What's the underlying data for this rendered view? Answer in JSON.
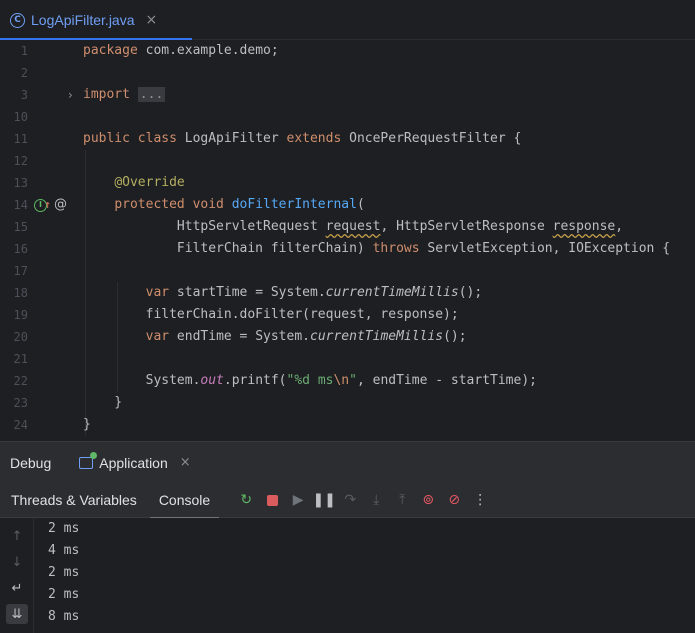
{
  "editor_tab": {
    "file_name": "LogApiFilter.java",
    "icon": "java-class-icon",
    "close": "×"
  },
  "code_lines": [
    {
      "ln": "1",
      "parts": [
        [
          "kw",
          "package"
        ],
        [
          "t",
          " com.example.demo;"
        ]
      ]
    },
    {
      "ln": "2",
      "parts": []
    },
    {
      "ln": "3",
      "parts": [
        [
          "kw",
          "import"
        ],
        [
          "t",
          " "
        ],
        [
          "fold",
          "..."
        ]
      ],
      "fold": true
    },
    {
      "ln": "10",
      "parts": []
    },
    {
      "ln": "11",
      "parts": [
        [
          "kw",
          "public class"
        ],
        [
          "t",
          " LogApiFilter "
        ],
        [
          "kw",
          "extends"
        ],
        [
          "t",
          " OncePerRequestFilter {"
        ]
      ]
    },
    {
      "ln": "12",
      "parts": []
    },
    {
      "ln": "13",
      "parts": [
        [
          "t",
          "    "
        ],
        [
          "ann",
          "@Override"
        ]
      ]
    },
    {
      "ln": "14",
      "parts": [
        [
          "t",
          "    "
        ],
        [
          "kw",
          "protected void"
        ],
        [
          "t",
          " "
        ],
        [
          "fn",
          "doFilterInternal"
        ],
        [
          "t",
          "("
        ]
      ],
      "gutter": true
    },
    {
      "ln": "15",
      "parts": [
        [
          "t",
          "            HttpServletRequest "
        ],
        [
          "warn",
          "request"
        ],
        [
          "t",
          ", HttpServletResponse "
        ],
        [
          "warn",
          "response"
        ],
        [
          "t",
          ","
        ]
      ]
    },
    {
      "ln": "16",
      "parts": [
        [
          "t",
          "            FilterChain filterChain) "
        ],
        [
          "kw",
          "throws"
        ],
        [
          "t",
          " ServletException, IOException {"
        ]
      ]
    },
    {
      "ln": "17",
      "parts": []
    },
    {
      "ln": "18",
      "parts": [
        [
          "t",
          "        "
        ],
        [
          "kw",
          "var"
        ],
        [
          "t",
          " startTime = System."
        ],
        [
          "ital",
          "currentTimeMillis"
        ],
        [
          "t",
          "();"
        ]
      ]
    },
    {
      "ln": "19",
      "parts": [
        [
          "t",
          "        filterChain.doFilter(request, response);"
        ]
      ]
    },
    {
      "ln": "20",
      "parts": [
        [
          "t",
          "        "
        ],
        [
          "kw",
          "var"
        ],
        [
          "t",
          " endTime = System."
        ],
        [
          "ital",
          "currentTimeMillis"
        ],
        [
          "t",
          "();"
        ]
      ]
    },
    {
      "ln": "21",
      "parts": []
    },
    {
      "ln": "22",
      "parts": [
        [
          "t",
          "        System."
        ],
        [
          "sf",
          "out"
        ],
        [
          "t",
          ".printf("
        ],
        [
          "str",
          "\"%d ms"
        ],
        [
          "esc",
          "\\n"
        ],
        [
          "str",
          "\""
        ],
        [
          "t",
          ", endTime - startTime);"
        ]
      ]
    },
    {
      "ln": "23",
      "parts": [
        [
          "t",
          "    }"
        ]
      ]
    },
    {
      "ln": "24",
      "parts": [
        [
          "t",
          "}"
        ]
      ]
    }
  ],
  "debug": {
    "title": "Debug",
    "session_tab": "Application",
    "session_close": "×",
    "tabs": [
      "Threads & Variables",
      "Console"
    ],
    "toolbar_icons": [
      "rerun-icon",
      "stop-icon",
      "resume-icon",
      "pause-icon",
      "step-over-icon",
      "step-into-icon",
      "step-out-icon",
      "view-breakpoints-icon",
      "mute-breakpoints-icon",
      "more-icon"
    ]
  },
  "console_output": [
    "2 ms",
    "4 ms",
    "2 ms",
    "2 ms",
    "8 ms"
  ],
  "console_gutter_icons": [
    "up-arrow-icon",
    "down-arrow-icon",
    "soft-wrap-icon",
    "scroll-to-end-icon"
  ],
  "colors": {
    "accent": "#3574f0",
    "keyword": "#cf8e6d",
    "annotation": "#b3ae60",
    "function": "#56a8f5",
    "string": "#6aab73",
    "stop": "#db5c5c",
    "breakpoint": "#e55765"
  }
}
